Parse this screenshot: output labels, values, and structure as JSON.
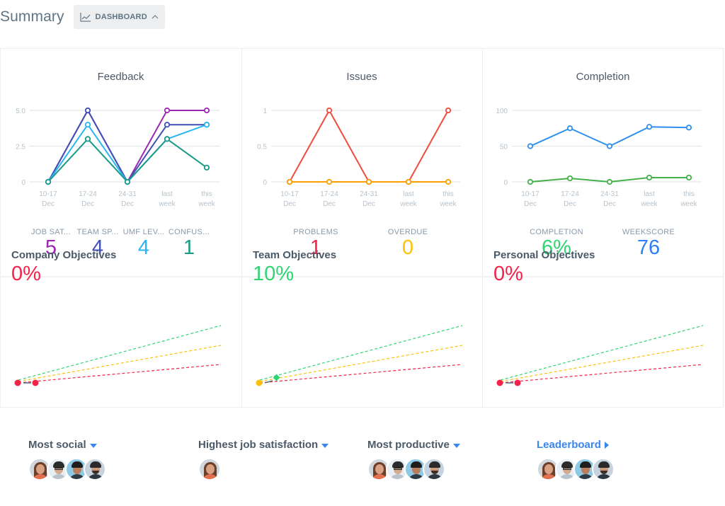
{
  "header": {
    "title": "Summary",
    "dashboard_button": "DASHBOARD"
  },
  "chart_data": [
    {
      "type": "line",
      "title": "Feedback",
      "categories": [
        [
          "10-17",
          "Dec"
        ],
        [
          "17-24",
          "Dec"
        ],
        [
          "24-31",
          "Dec"
        ],
        [
          "last",
          "week"
        ],
        [
          "this",
          "week"
        ]
      ],
      "yticks": [
        "0",
        "2.5",
        "5.0"
      ],
      "ylim": [
        0,
        5
      ],
      "series": [
        {
          "name": "Job satisfaction",
          "color": "#9c27b0",
          "values": [
            0,
            5,
            0,
            5,
            5
          ]
        },
        {
          "name": "Team spirit",
          "color": "#3f51b5",
          "values": [
            0,
            5,
            0,
            4,
            4
          ]
        },
        {
          "name": "UMF level",
          "color": "#29b6f6",
          "values": [
            0,
            4,
            0,
            3,
            4
          ]
        },
        {
          "name": "Confusion",
          "color": "#1a9a87",
          "values": [
            0,
            3,
            0,
            3,
            1
          ]
        }
      ]
    },
    {
      "type": "line",
      "title": "Issues",
      "categories": [
        [
          "10-17",
          "Dec"
        ],
        [
          "17-24",
          "Dec"
        ],
        [
          "24-31",
          "Dec"
        ],
        [
          "last",
          "week"
        ],
        [
          "this",
          "week"
        ]
      ],
      "yticks": [
        "0",
        "0.5",
        "1"
      ],
      "ylim": [
        0,
        1
      ],
      "series": [
        {
          "name": "Problems",
          "color": "#f24b3c",
          "values": [
            0,
            1,
            0,
            0,
            1
          ]
        },
        {
          "name": "Overdue",
          "color": "#ffa000",
          "values": [
            0,
            0,
            0,
            0,
            0
          ]
        }
      ]
    },
    {
      "type": "line",
      "title": "Completion",
      "categories": [
        [
          "10-17",
          "Dec"
        ],
        [
          "17-24",
          "Dec"
        ],
        [
          "24-31",
          "Dec"
        ],
        [
          "last",
          "week"
        ],
        [
          "this",
          "week"
        ]
      ],
      "yticks": [
        "0",
        "50",
        "100"
      ],
      "ylim": [
        0,
        100
      ],
      "series": [
        {
          "name": "Weekscore",
          "color": "#2e8ff0",
          "values": [
            50,
            75,
            50,
            77,
            76
          ]
        },
        {
          "name": "Completion",
          "color": "#43b04a",
          "values": [
            0,
            5,
            0,
            6,
            6
          ]
        }
      ]
    }
  ],
  "kpis": {
    "feedback": [
      {
        "label": "JOB SAT...",
        "value": "5",
        "color": "#9c27b0"
      },
      {
        "label": "TEAM SP...",
        "value": "4",
        "color": "#3f51b5"
      },
      {
        "label": "UMF LEV...",
        "value": "4",
        "color": "#29b6f6"
      },
      {
        "label": "CONFUS...",
        "value": "1",
        "color": "#1a9a87"
      }
    ],
    "issues": [
      {
        "label": "PROBLEMS",
        "value": "1",
        "color": "#f5224a"
      },
      {
        "label": "OVERDUE",
        "value": "0",
        "color": "#ffc107"
      }
    ],
    "completion": [
      {
        "label": "COMPLETION",
        "value": "6%",
        "color": "#2ed573"
      },
      {
        "label": "WEEKSCORE",
        "value": "76",
        "color": "#2e7cf6"
      }
    ]
  },
  "objectives": [
    {
      "title": "Company Objectives",
      "percent": "0%",
      "percent_color": "#f5224a",
      "progress": 0,
      "start_marker": "red-dot",
      "end_marker": "red-dot"
    },
    {
      "title": "Team Objectives",
      "percent": "10%",
      "percent_color": "#2ed573",
      "progress": 10,
      "start_marker": "yellow-dot",
      "end_marker": "green-diamond"
    },
    {
      "title": "Personal Objectives",
      "percent": "0%",
      "percent_color": "#f5224a",
      "progress": 0,
      "start_marker": "red-dot",
      "end_marker": "red-dot"
    }
  ],
  "objective_guides": {
    "green": "#2ed573",
    "yellow": "#ffc107",
    "red": "#f5224a"
  },
  "bottom": [
    {
      "title": "Most social",
      "kind": "dropdown",
      "avatars": [
        "woman-long-hair",
        "man-glasses",
        "man-smiling",
        "man-beard"
      ]
    },
    {
      "title": "Highest job satisfaction",
      "kind": "dropdown",
      "avatars": [
        "woman-long-hair"
      ]
    },
    {
      "title": "Most productive",
      "kind": "dropdown",
      "avatars": [
        "woman-long-hair",
        "man-glasses",
        "man-smiling",
        "man-beard"
      ]
    },
    {
      "title": "Leaderboard",
      "kind": "link",
      "avatars": [
        "woman-long-hair",
        "man-glasses",
        "man-smiling",
        "man-beard"
      ]
    }
  ]
}
